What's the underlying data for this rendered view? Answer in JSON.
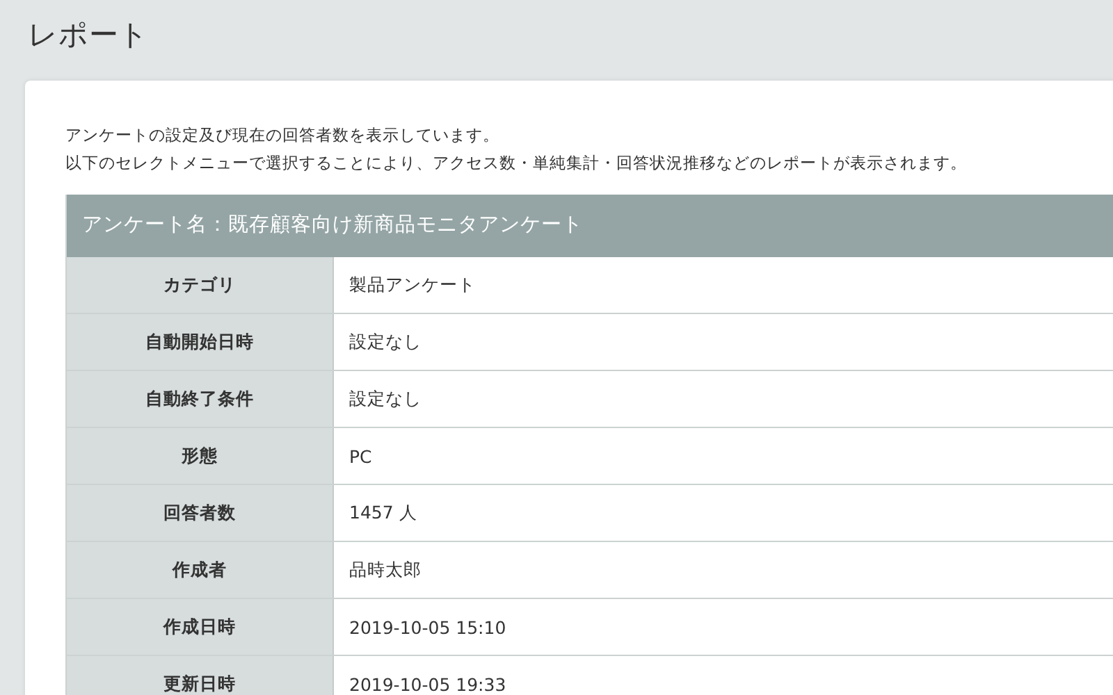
{
  "page_title": "レポート",
  "description": [
    "アンケートの設定及び現在の回答者数を表示しています。",
    "以下のセレクトメニューで選択することにより、アクセス数・単純集計・回答状況推移などのレポートが表示されます。"
  ],
  "table": {
    "header": "アンケート名：既存顧客向け新商品モニタアンケート",
    "rows": [
      {
        "label": "カテゴリ",
        "value": "製品アンケート"
      },
      {
        "label": "自動開始日時",
        "value": "設定なし"
      },
      {
        "label": "自動終了条件",
        "value": "設定なし"
      },
      {
        "label": "形態",
        "value": "PC"
      },
      {
        "label": "回答者数",
        "value": "1457 人"
      },
      {
        "label": "作成者",
        "value": "品時太郎"
      },
      {
        "label": "作成日時",
        "value": "2019-10-05 15:10"
      },
      {
        "label": "更新日時",
        "value": "2019-10-05 19:33"
      }
    ]
  }
}
